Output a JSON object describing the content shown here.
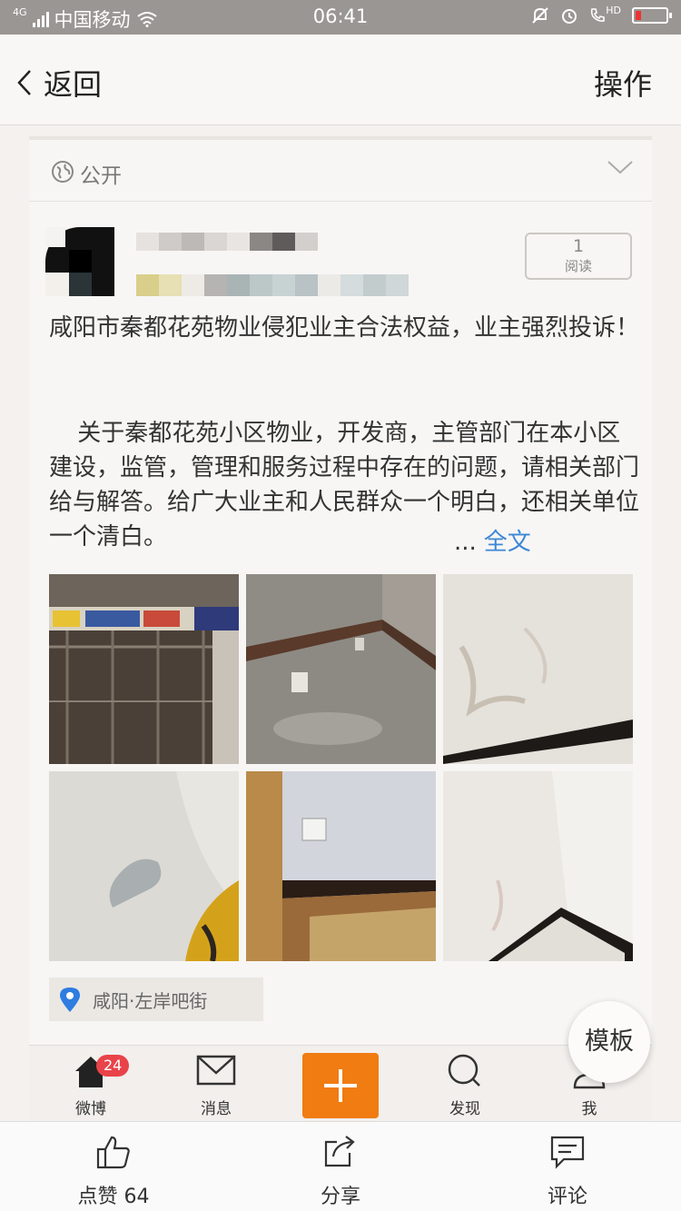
{
  "status_bar": {
    "network": "4G",
    "carrier": "中国移动",
    "time": "06:41",
    "hd": "HD",
    "icons": [
      "signal-icon",
      "wifi-icon",
      "mute-icon",
      "alarm-icon",
      "call-icon",
      "battery-icon"
    ]
  },
  "nav": {
    "back_label": "返回",
    "action_label": "操作"
  },
  "privacy": {
    "label": "公开"
  },
  "post": {
    "read_count": "1",
    "read_label": "阅读",
    "title": "咸阳市秦都花苑物业侵犯业主合法权益，业主强烈投诉！",
    "body": "关于秦都花苑小区物业，开发商，主管部门在本小区建设，监管，管理和服务过程中存在的问题，请相关部门给与解答。给广大业主和人民群众一个明白，还相关单位一个清白。",
    "ellipsis": "...",
    "full_text_link": "全文",
    "photos": [
      {
        "name": "elevator-shaft-photo"
      },
      {
        "name": "wet-floor-photo"
      },
      {
        "name": "stained-wall-photo"
      },
      {
        "name": "water-stain-wall-photo"
      },
      {
        "name": "room-corner-photo"
      },
      {
        "name": "wall-corner-photo"
      }
    ],
    "location": "咸阳·左岸吧街"
  },
  "tab_bar": {
    "items": [
      {
        "label": "微博",
        "badge": "24"
      },
      {
        "label": "消息"
      },
      {
        "label": "发现"
      },
      {
        "label": "我"
      }
    ]
  },
  "template_button": "模板",
  "action_bar": {
    "like_label": "点赞 64",
    "share_label": "分享",
    "comment_label": "评论"
  },
  "colors": {
    "link": "#3c87d6",
    "compose_button": "#f07c12",
    "badge": "#e9434a"
  }
}
